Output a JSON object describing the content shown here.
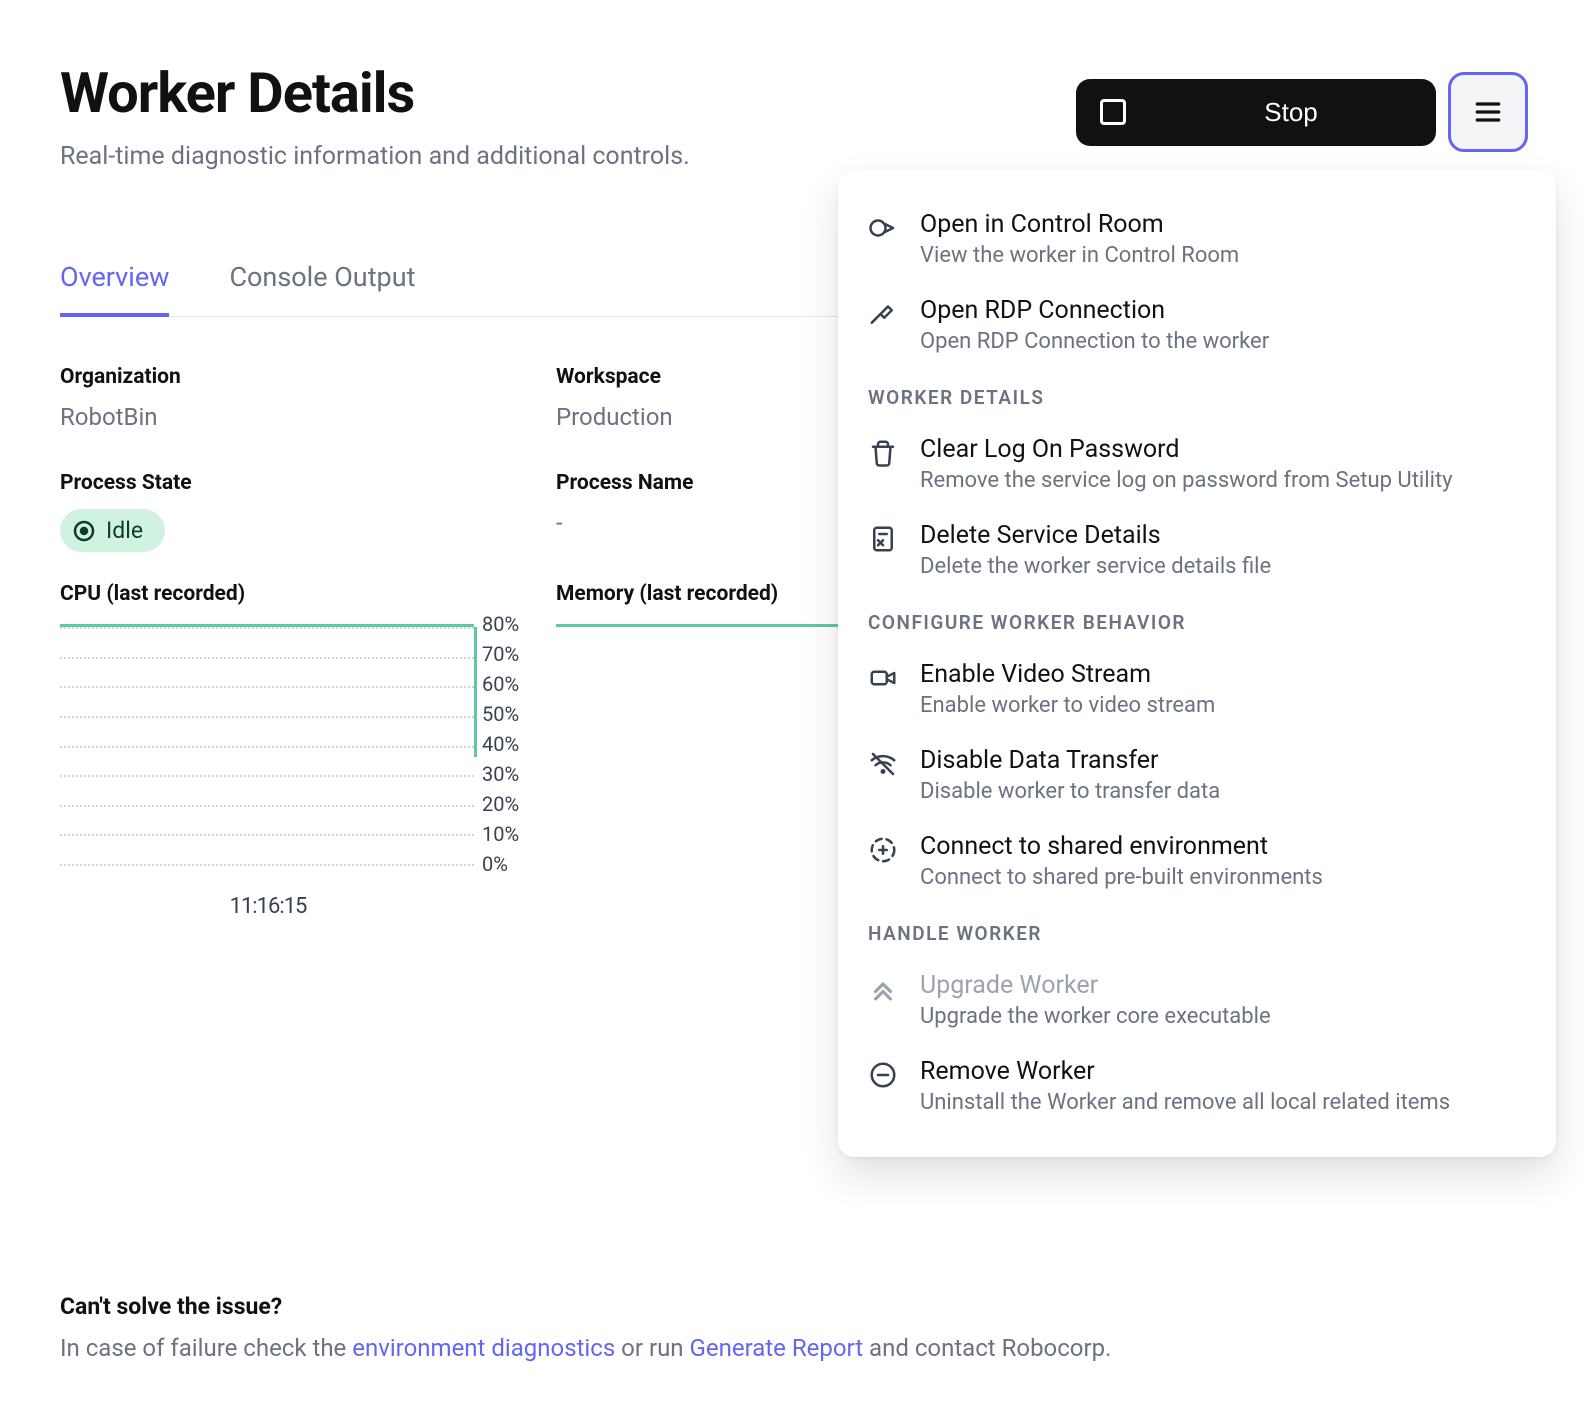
{
  "header": {
    "title": "Worker Details",
    "subtitle": "Real-time diagnostic information and additional controls.",
    "stop_label": "Stop"
  },
  "tabs": {
    "overview": "Overview",
    "console": "Console Output"
  },
  "fields": {
    "organization_label": "Organization",
    "organization_value": "RobotBin",
    "workspace_label": "Workspace",
    "workspace_value": "Production",
    "process_state_label": "Process State",
    "process_state_value": "Idle",
    "process_name_label": "Process Name",
    "process_name_value": "-",
    "cpu_label": "CPU (last recorded)",
    "memory_label": "Memory (last recorded)"
  },
  "chart_data": {
    "type": "line",
    "charts": [
      {
        "name": "CPU (last recorded)",
        "y_ticks": [
          "80%",
          "70%",
          "60%",
          "50%",
          "40%",
          "30%",
          "20%",
          "10%",
          "0%"
        ],
        "x_ticks": [
          "11:16:15"
        ],
        "series": [
          {
            "name": "CPU",
            "values": [
              80
            ]
          }
        ]
      },
      {
        "name": "Memory (last recorded)",
        "y_ticks": [],
        "x_ticks": [],
        "series": [
          {
            "name": "Memory",
            "values": []
          }
        ]
      }
    ]
  },
  "menu": {
    "items_top": [
      {
        "title": "Open in Control Room",
        "desc": "View the worker in Control Room"
      },
      {
        "title": "Open RDP Connection",
        "desc": "Open RDP Connection to the worker"
      }
    ],
    "section_worker_details": "WORKER DETAILS",
    "items_worker_details": [
      {
        "title": "Clear Log On Password",
        "desc": "Remove the service log on password from Setup Utility"
      },
      {
        "title": "Delete Service Details",
        "desc": "Delete the worker service details file"
      }
    ],
    "section_configure": "CONFIGURE WORKER BEHAVIOR",
    "items_configure": [
      {
        "title": "Enable Video Stream",
        "desc": "Enable worker to video stream"
      },
      {
        "title": "Disable Data Transfer",
        "desc": "Disable worker to transfer data"
      },
      {
        "title": "Connect to shared environment",
        "desc": "Connect to shared pre-built environments"
      }
    ],
    "section_handle": "HANDLE WORKER",
    "items_handle": [
      {
        "title": "Upgrade Worker",
        "desc": "Upgrade the worker core executable",
        "disabled": true
      },
      {
        "title": "Remove Worker",
        "desc": "Uninstall the Worker and remove all local related items"
      }
    ]
  },
  "footer": {
    "heading": "Can't solve the issue?",
    "prefix": "In case of failure check the ",
    "link1": "environment diagnostics",
    "mid": " or run ",
    "link2": "Generate Report",
    "suffix": " and contact Robocorp."
  }
}
